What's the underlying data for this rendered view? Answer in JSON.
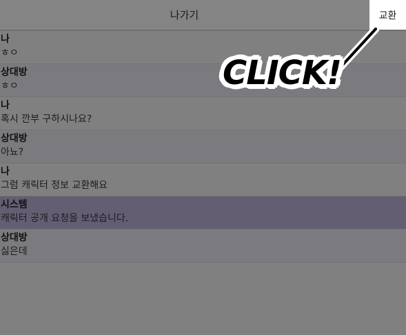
{
  "topbar": {
    "leave_label": "나가기",
    "exchange_label": "교환"
  },
  "messages": [
    {
      "sender": "나",
      "text": "ㅎㅇ",
      "kind": "me"
    },
    {
      "sender": "상대방",
      "text": "ㅎㅇ",
      "kind": "other"
    },
    {
      "sender": "나",
      "text": "혹시 깐부 구하시나요?",
      "kind": "me"
    },
    {
      "sender": "상대방",
      "text": "아뇨?",
      "kind": "other"
    },
    {
      "sender": "나",
      "text": "그럼 캐릭터 정보 교환해요",
      "kind": "me"
    },
    {
      "sender": "시스템",
      "text": "캐릭터 공개 요청을 보냈습니다.",
      "kind": "system"
    },
    {
      "sender": "상대방",
      "text": "싫은데",
      "kind": "other"
    }
  ],
  "overlay": {
    "callout_text": "CLICK!"
  },
  "colors": {
    "dim_overlay": "#808080",
    "system_row": "#645e73",
    "highlight": "#ffffff"
  }
}
